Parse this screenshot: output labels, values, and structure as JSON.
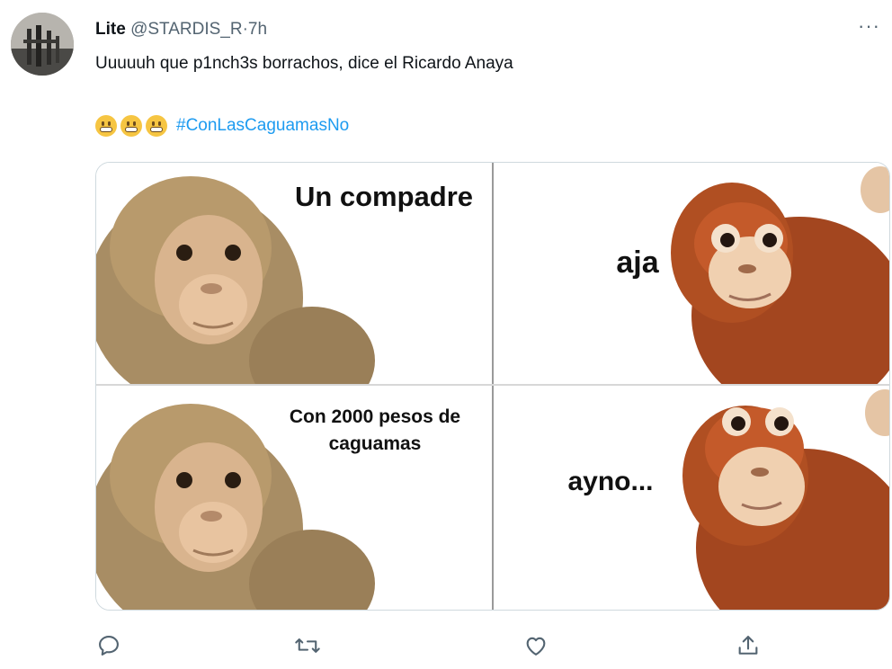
{
  "tweet": {
    "name": "Lite",
    "handle": "@STARDIS_R",
    "separator": "·",
    "time": "7h",
    "more": "···",
    "text": "Uuuuuh que p1nch3s borrachos, dice el Ricardo Anaya",
    "emojis": [
      "grimacing-face",
      "grimacing-face",
      "grimacing-face"
    ],
    "hashtag": "#ConLasCaguamasNo"
  },
  "meme": {
    "panels": [
      {
        "caption": "Un compadre",
        "character": "tan-monkey-plush"
      },
      {
        "caption": "aja",
        "character": "orangutan-plush"
      },
      {
        "caption": "Con 2000 pesos de caguamas",
        "character": "tan-monkey-plush"
      },
      {
        "caption": "ayno...",
        "character": "orangutan-plush"
      }
    ]
  },
  "actions": [
    {
      "icon": "reply-icon"
    },
    {
      "icon": "retweet-icon"
    },
    {
      "icon": "like-icon"
    },
    {
      "icon": "share-icon"
    }
  ],
  "colors": {
    "accent": "#1d9bf0",
    "secondary_text": "#536471",
    "border": "#cfd9de"
  }
}
